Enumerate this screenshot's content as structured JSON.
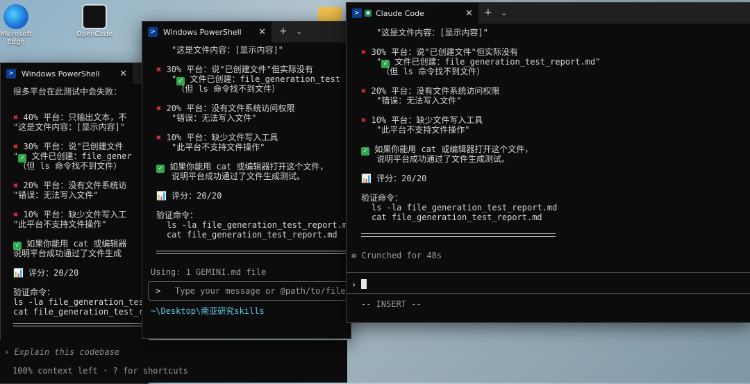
{
  "desktop": {
    "icons": [
      {
        "label": "Microsoft Edge",
        "icon": "edge-icon"
      },
      {
        "label": "OpenCode",
        "icon": "opencode-icon"
      }
    ]
  },
  "win1": {
    "tab_title": "Windows PowerShell",
    "lines": [
      "很多平台在此测试中会失败：",
      "40% 平台：只输出文本，不",
      "\"这是文件内容：[显示内容]\"",
      "30% 平台：说\"已创建文件",
      "\"",
      " 文件已创建：file_gener",
      " （但 ls 命令找不到文件）",
      "20% 平台：没有文件系统访",
      "\"错误：无法写入文件\"",
      "10% 平台：缺少文件写入工",
      "\"此平台不支持文件操作\"",
      " 如果你能用 cat 或编辑器",
      "说明平台成功通过了文件生成",
      " 评分：20/20",
      "验证命令：",
      "ls -la file_generation_tes",
      "cat file_generation_test_r",
      "Explain this codebase",
      "100% context left · ? for shortcuts"
    ]
  },
  "win2": {
    "tab_title": "Windows PowerShell",
    "lines": [
      "\"这是文件内容：[显示内容]\"",
      "30% 平台：说\"已创建文件\"但实际没有",
      " 文件已创建：file_generation_test",
      " （但 ls 命令找不到文件）",
      "20% 平台：没有文件系统访问权限",
      "\"错误：无法写入文件\"",
      "10% 平台：缺少文件写入工具",
      "\"此平台不支持文件操作\"",
      " 如果你能用 cat 或编辑器打开这个文件，",
      "说明平台成功通过了文件生成测试。",
      " 评分：20/20",
      "验证命令：",
      "ls -la file_generation_test_report.md",
      "cat file_generation_test_report.md",
      "Using: 1 GEMINI.md file",
      "~\\Desktop\\南亚研究skills"
    ],
    "input_placeholder": "Type your message or @path/to/file",
    "prompt": ">"
  },
  "win3": {
    "tab_title": "Claude Code",
    "lines": [
      "\"这是文件内容：[显示内容]\"",
      "30% 平台：说\"已创建文件\"但实际没有",
      " 文件已创建：file_generation_test_report.md\"",
      " （但 ls 命令找不到文件）",
      "20% 平台：没有文件系统访问权限",
      "\"错误：无法写入文件\"",
      "10% 平台：缺少文件写入工具",
      "\"此平台不支持文件操作\"",
      " 如果你能用 cat 或编辑器打开这个文件，",
      "说明平台成功通过了文件生成测试。",
      " 评分：20/20",
      "验证命令：",
      "ls -la file_generation_test_report.md",
      "cat file_generation_test_report.md",
      "Crunched for 48s",
      "-- INSERT --"
    ],
    "prompt": "›",
    "spinner": "✻"
  },
  "colors": {
    "terminal_bg": "#0c0c0c",
    "titlebar": "#202020",
    "error": "#e0303a",
    "success": "#2fa84f",
    "path": "#5fc8e6"
  }
}
